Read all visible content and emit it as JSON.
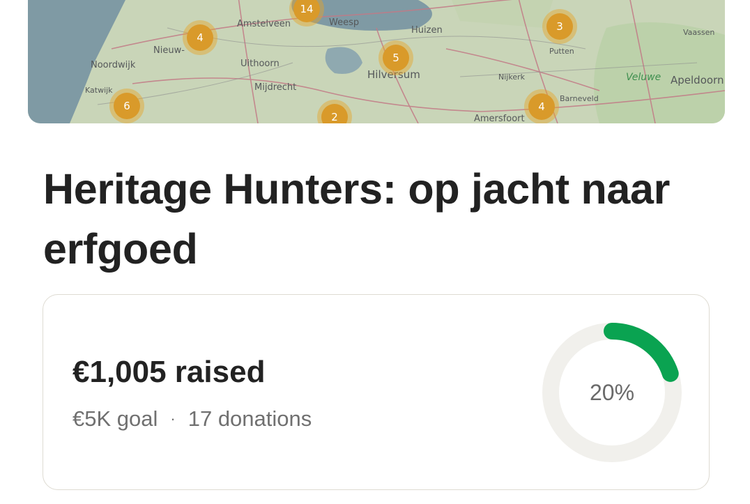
{
  "map": {
    "towns": [
      "Noordwijk",
      "Katwijk",
      "Nieuw-",
      "Amstelveen",
      "Weesp",
      "Huizen",
      "Uithoorn",
      "Mijdrecht",
      "Hilversum",
      "Nijkerk",
      "Putten",
      "Vaassen",
      "Veluwe",
      "Apeldoorn",
      "Amersfoort",
      "Barneveld"
    ],
    "clusters": [
      "14",
      "4",
      "3",
      "5",
      "6",
      "2",
      "4"
    ]
  },
  "project": {
    "title": "Heritage Hunters: op jacht naar erfgoed"
  },
  "fundraising": {
    "raised": "€1,005 raised",
    "goal": "€5K goal",
    "separator": "·",
    "donations": "17 donations",
    "percent_label": "20%",
    "progress": 0.2,
    "progress_color": "#0aa351",
    "track_color": "#f1f0ec"
  }
}
